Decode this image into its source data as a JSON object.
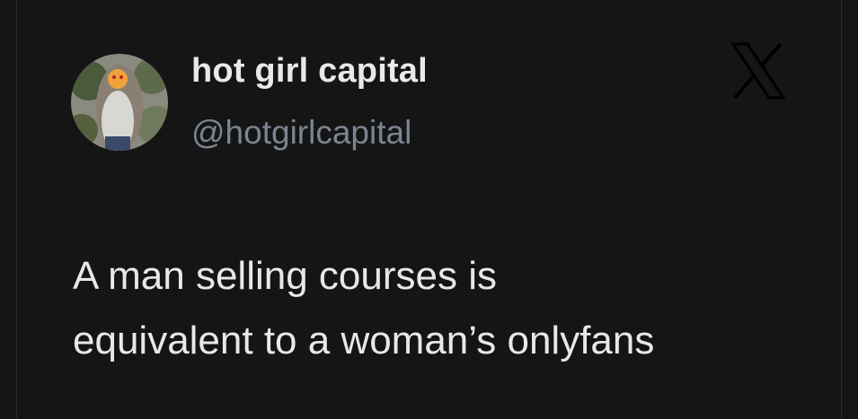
{
  "author": {
    "display_name": "hot girl capital",
    "handle": "@hotgirlcapital",
    "avatar_icon": "profile-photo"
  },
  "brand": {
    "logo_icon": "x-logo-icon"
  },
  "tweet": {
    "text_lines": [
      "A man selling courses is",
      "equivalent to a woman’s onlyfans"
    ]
  },
  "colors": {
    "background": "#151515",
    "name": "#e9e9e9",
    "handle": "#7b8591",
    "text": "#e8e8e8"
  }
}
